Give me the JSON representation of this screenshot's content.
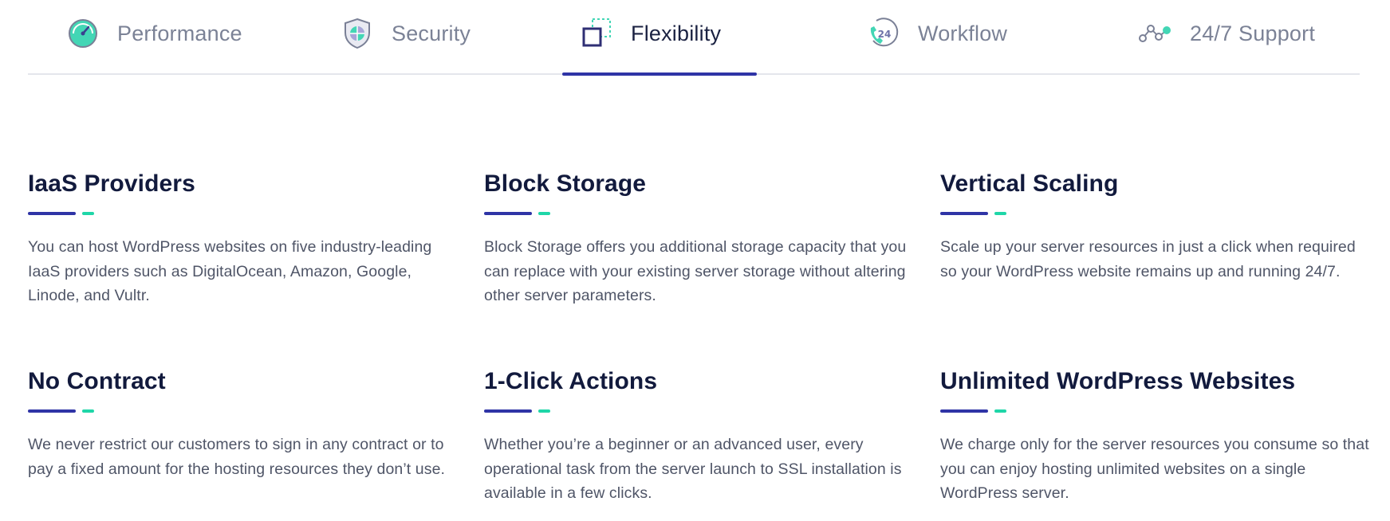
{
  "tabs": [
    {
      "label": "Performance",
      "icon": "speedometer-icon",
      "active": false
    },
    {
      "label": "Security",
      "icon": "shield-icon",
      "active": false
    },
    {
      "label": "Flexibility",
      "icon": "resize-squares-icon",
      "active": true
    },
    {
      "label": "Workflow",
      "icon": "phone-24-icon",
      "active": false
    },
    {
      "label": "24/7 Support",
      "icon": "connected-nodes-icon",
      "active": false
    }
  ],
  "features": [
    {
      "title": "IaaS Providers",
      "description": "You can host WordPress websites on five industry-leading IaaS providers such as DigitalOcean, Amazon, Google, Linode, and Vultr."
    },
    {
      "title": "Block Storage",
      "description": "Block Storage offers you additional storage capacity that you can replace with your existing server storage without altering other server parameters."
    },
    {
      "title": "Vertical Scaling",
      "description": "Scale up your server resources in just a click when required so your WordPress website remains up and running 24/7."
    },
    {
      "title": "No Contract",
      "description": "We never restrict our customers to sign in any contract or to pay a fixed amount for the hosting resources they don’t use."
    },
    {
      "title": "1-Click Actions",
      "description": "Whether you’re a beginner or an advanced user, every operational task from the server launch to SSL installation is available in a few clicks."
    },
    {
      "title": "Unlimited WordPress Websites",
      "description": "We charge only for the server resources you consume so that you can enjoy hosting unlimited websites on a single WordPress server."
    }
  ],
  "colors": {
    "accent_blue": "#2f34a6",
    "accent_green": "#1fd6a8",
    "heading": "#121a3d",
    "body_text": "#4f5567",
    "tab_inactive": "#7b8296"
  }
}
